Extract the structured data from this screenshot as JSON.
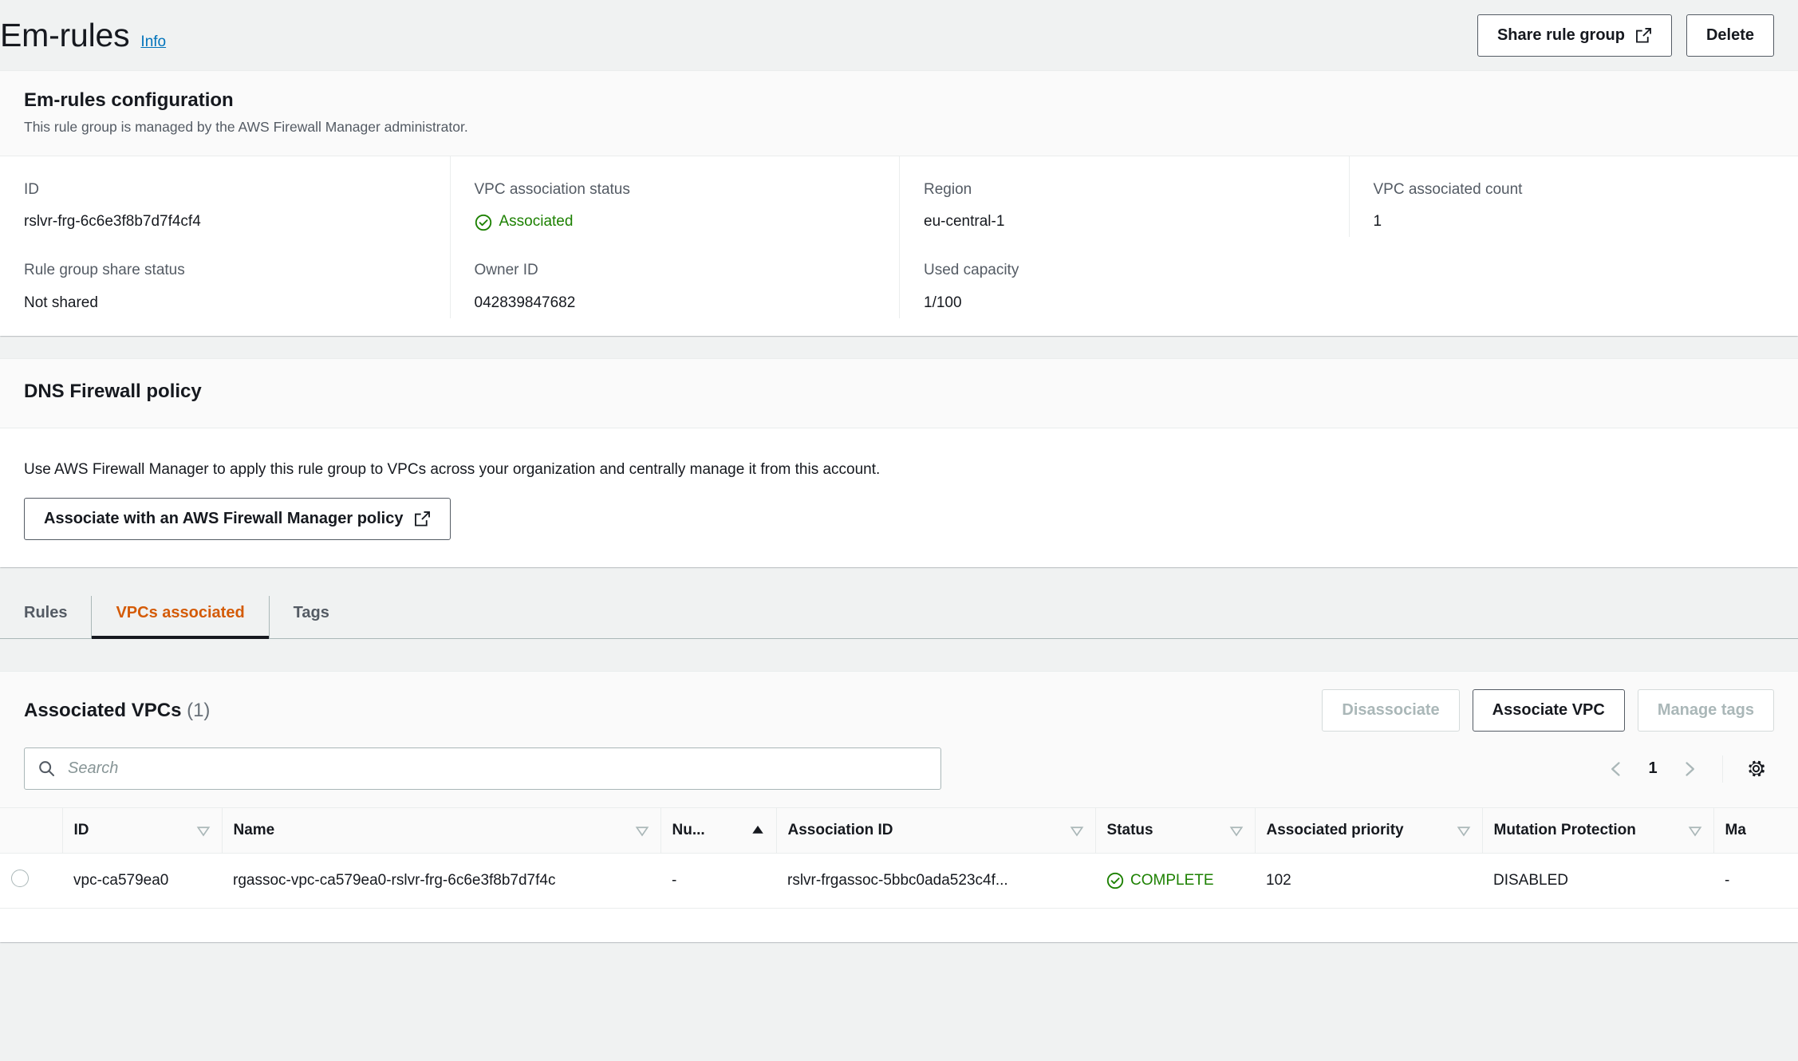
{
  "header": {
    "title": "Em-rules",
    "info_label": "Info",
    "share_button": "Share rule group",
    "delete_button": "Delete",
    "external_link_icon": "external-link-icon"
  },
  "configuration": {
    "title": "Em-rules configuration",
    "subtitle": "This rule group is managed by the AWS Firewall Manager administrator.",
    "fields": [
      {
        "label": "ID",
        "value": "rslvr-frg-6c6e3f8b7d7f4cf4",
        "status": false
      },
      {
        "label": "VPC association status",
        "value": "Associated",
        "status": true
      },
      {
        "label": "Region",
        "value": "eu-central-1",
        "status": false
      },
      {
        "label": "VPC associated count",
        "value": "1",
        "status": false
      },
      {
        "label": "Rule group share status",
        "value": "Not shared",
        "status": false
      },
      {
        "label": "Owner ID",
        "value": "042839847682",
        "status": false
      },
      {
        "label": "Used capacity",
        "value": "1/100",
        "status": false
      }
    ]
  },
  "dns_firewall_policy": {
    "title": "DNS Firewall policy",
    "description": "Use AWS Firewall Manager to apply this rule group to VPCs across your organization and centrally manage it from this account.",
    "button": "Associate with an AWS Firewall Manager policy"
  },
  "tabs": [
    {
      "label": "Rules",
      "active": false
    },
    {
      "label": "VPCs associated",
      "active": true
    },
    {
      "label": "Tags",
      "active": false
    }
  ],
  "table_panel": {
    "title": "Associated VPCs",
    "count": "(1)",
    "buttons": {
      "disassociate": "Disassociate",
      "associate_vpc": "Associate VPC",
      "manage_tags": "Manage tags"
    },
    "search_placeholder": "Search",
    "search_value": "",
    "pagination": {
      "page": "1"
    },
    "settings_icon": "gear-icon",
    "columns": [
      {
        "label": "ID",
        "sortable": true,
        "sorted": false
      },
      {
        "label": "Name",
        "sortable": true,
        "sorted": false
      },
      {
        "label": "Nu...",
        "sortable": true,
        "sorted": true
      },
      {
        "label": "Association ID",
        "sortable": true,
        "sorted": false
      },
      {
        "label": "Status",
        "sortable": true,
        "sorted": false
      },
      {
        "label": "Associated priority",
        "sortable": true,
        "sorted": false
      },
      {
        "label": "Mutation Protection",
        "sortable": true,
        "sorted": false
      },
      {
        "label": "Ma",
        "sortable": false,
        "sorted": false
      }
    ],
    "rows": [
      {
        "id": "vpc-ca579ea0",
        "name": "rgassoc-vpc-ca579ea0-rslvr-frg-6c6e3f8b7d7f4c",
        "number": "-",
        "association_id": "rslvr-frgassoc-5bbc0ada523c4f...",
        "status": "COMPLETE",
        "associated_priority": "102",
        "mutation_protection": "DISABLED",
        "managed": "-"
      }
    ]
  },
  "colors": {
    "accent_orange": "#d45b07",
    "link_blue": "#0073bb",
    "status_green": "#1d8102",
    "page_bg": "#f0f2f2"
  }
}
